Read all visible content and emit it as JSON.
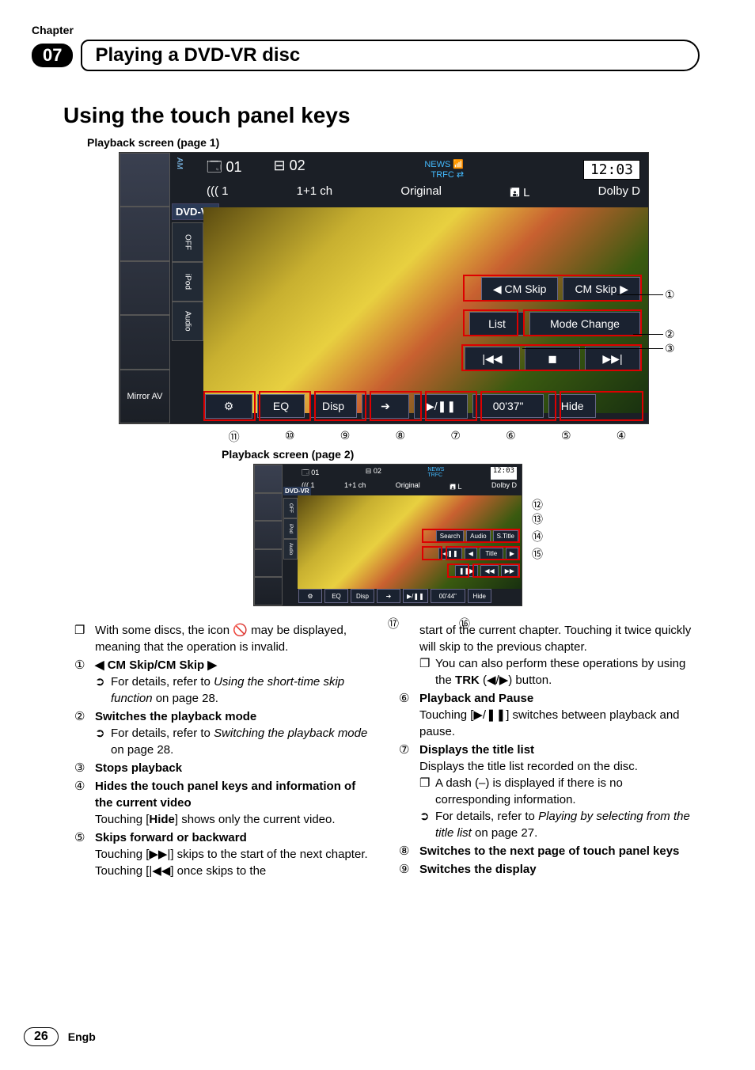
{
  "header": {
    "chapter_label": "Chapter",
    "chapter_num": "07",
    "chapter_title": "Playing a DVD-VR disc"
  },
  "h2": "Using the touch panel keys",
  "screen1": {
    "caption": "Playback screen (page 1)",
    "am": "AM",
    "title": "01",
    "chapter": "02",
    "news": "NEWS",
    "trfc": "TRFC",
    "clock": "12:03",
    "audio_ch": "((( 1",
    "ch_mode": "1+1 ch",
    "play_mode": "Original",
    "disc_side": "L",
    "dolby": "Dolby D",
    "side_items": [
      "",
      "",
      "",
      "",
      "Mirror AV"
    ],
    "dvdvr": "DVD-VR",
    "side2": [
      "OFF",
      "iPod",
      "Audio"
    ],
    "side_icons": [
      "Off",
      "",
      "✱"
    ],
    "cm_back": "◀ CM Skip",
    "cm_fwd": "CM Skip ▶",
    "list": "List",
    "mode_change": "Mode Change",
    "prev": "|◀◀",
    "stop": "◼",
    "next": "▶▶|",
    "gear": "⚙",
    "eq": "EQ",
    "disp": "Disp",
    "arrow": "➔",
    "playpause": "▶/❚❚",
    "time": "00'37\"",
    "hide": "Hide"
  },
  "screen2": {
    "caption": "Playback screen (page 2)",
    "title": "01",
    "chapter": "02",
    "news": "NEWS",
    "trfc": "TRFC",
    "clock": "12:03",
    "audio_ch": "((( 1",
    "ch_mode": "1+1 ch",
    "play_mode": "Original",
    "disc_side": "L",
    "dolby": "Dolby D",
    "dvdvr": "DVD-VR",
    "side_icons": [
      "Off",
      "",
      "✱",
      ""
    ],
    "search": "Search",
    "audio": "Audio",
    "stitle": "S.Title",
    "frame_back": "◀❚❚",
    "title_lbl": "Title",
    "title_back": "◀",
    "title_fwd": "▶",
    "slow": "❚❚▶",
    "rew": "◀◀",
    "ff": "▶▶",
    "gear": "⚙",
    "eq": "EQ",
    "disp": "Disp",
    "arrow": "➔",
    "playpause": "▶/❚❚",
    "time": "00'44\"",
    "hide": "Hide"
  },
  "annotations": {
    "bottom1": [
      "⑪",
      "⑩",
      "⑨",
      "⑧",
      "⑦",
      "⑥",
      "⑤",
      "④"
    ],
    "right1": [
      "①",
      "②",
      "③"
    ],
    "right2": [
      "⑫",
      "⑬",
      "⑭",
      "⑮"
    ],
    "bottom2": [
      "⑰",
      "⑯"
    ]
  },
  "body": {
    "left": {
      "note1a": "With some discs, the icon ",
      "note1b": " may be displayed, meaning that the operation is invalid.",
      "i1_title": "◀ CM Skip/CM Skip ▶",
      "i1_sub": "For details, refer to ",
      "i1_sub_i": "Using the short-time skip function",
      "i1_sub_p": " on page 28.",
      "i2_title": "Switches the playback mode",
      "i2_sub": "For details, refer to ",
      "i2_sub_i": "Switching the playback mode",
      "i2_sub_p": " on page 28.",
      "i3_title": "Stops playback",
      "i4_title": "Hides the touch panel keys and information of the current video",
      "i4_text_a": "Touching [",
      "i4_text_b": "Hide",
      "i4_text_c": "] shows only the current video.",
      "i5_title": "Skips forward or backward",
      "i5_text": "Touching [▶▶|] skips to the start of the next chapter. Touching [|◀◀] once skips to the"
    },
    "right": {
      "cont": "start of the current chapter. Touching it twice quickly will skip to the previous chapter.",
      "cont_sub_a": "You can also perform these operations by using the ",
      "cont_sub_b": "TRK",
      "cont_sub_c": " (◀/▶) button.",
      "i6_title": "Playback and Pause",
      "i6_text": "Touching [▶/❚❚] switches between playback and pause.",
      "i7_title": "Displays the title list",
      "i7_text": "Displays the title list recorded on the disc.",
      "i7_sub1": "A dash (–) is displayed if there is no corresponding information.",
      "i7_sub2a": "For details, refer to ",
      "i7_sub2i": "Playing by selecting from the title list",
      "i7_sub2p": " on page 27.",
      "i8_title": "Switches to the next page of touch panel keys",
      "i9_title": "Switches the display"
    }
  },
  "footer": {
    "page": "26",
    "lang": "Engb"
  },
  "circ": {
    "1": "①",
    "2": "②",
    "3": "③",
    "4": "④",
    "5": "⑤",
    "6": "⑥",
    "7": "⑦",
    "8": "⑧",
    "9": "⑨"
  }
}
